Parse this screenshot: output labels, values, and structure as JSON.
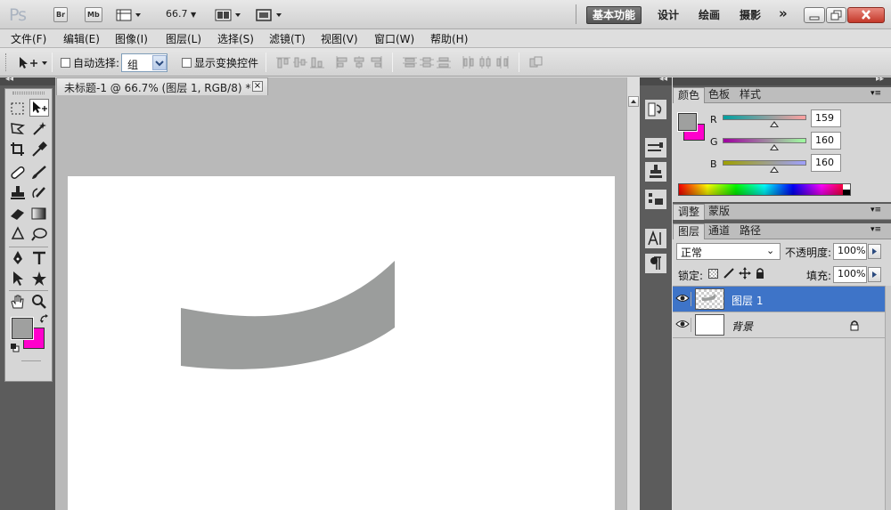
{
  "app": {
    "logo": "Ps"
  },
  "appbar": {
    "bridge_label": "Br",
    "minibridge_label": "Mb",
    "zoom": "66.7",
    "workspaces": [
      "基本功能",
      "设计",
      "绘画",
      "摄影"
    ],
    "more": "»"
  },
  "menus": [
    "文件(F)",
    "编辑(E)",
    "图像(I)",
    "图层(L)",
    "选择(S)",
    "滤镜(T)",
    "视图(V)",
    "窗口(W)",
    "帮助(H)"
  ],
  "options": {
    "auto_select_label": "自动选择:",
    "auto_select_checked": false,
    "auto_select_value": "组",
    "show_transform_label": "显示变换控件",
    "show_transform_checked": false
  },
  "document": {
    "tab_title": "未标题-1 @ 66.7% (图层 1, RGB/8) *",
    "close_symbol": "×",
    "shape_color": "#9b9d9c",
    "canvas_color": "#ffffff"
  },
  "colors": {
    "foreground": "#9fa09f",
    "background": "#ff00cc"
  },
  "color_panel": {
    "tabs": [
      "颜色",
      "色板",
      "样式"
    ],
    "active_tab": "颜色",
    "channels": [
      {
        "label": "R",
        "value": "159"
      },
      {
        "label": "G",
        "value": "160"
      },
      {
        "label": "B",
        "value": "160"
      }
    ]
  },
  "adjust_panel": {
    "tabs": [
      "调整",
      "蒙版"
    ]
  },
  "layers_panel": {
    "tabs": [
      "图层",
      "通道",
      "路径"
    ],
    "blend_mode": "正常",
    "opacity_label": "不透明度:",
    "opacity_value": "100%",
    "lock_label": "锁定:",
    "fill_label": "填充:",
    "fill_value": "100%",
    "layers": [
      {
        "name": "图层 1",
        "selected": true
      },
      {
        "name": "背景",
        "selected": false,
        "locked": true
      }
    ]
  }
}
